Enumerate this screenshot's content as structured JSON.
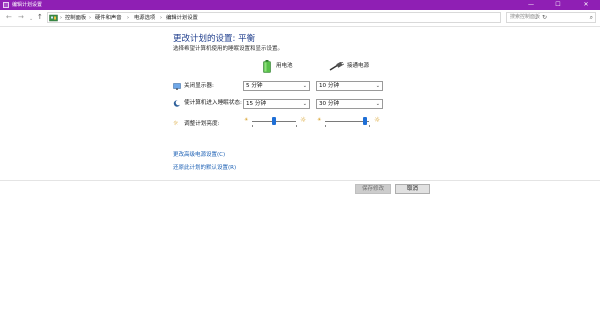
{
  "window": {
    "title": "编辑计划设置",
    "minimize": "—",
    "maximize": "☐",
    "close": "✕"
  },
  "nav": {
    "back": "←",
    "forward": "→",
    "recent": "⌄",
    "up": "↑"
  },
  "breadcrumbs": [
    "控制面板",
    "硬件和声音",
    "电源选项",
    "编辑计划设置"
  ],
  "breadcrumb_separator": "›",
  "search": {
    "placeholder": "搜索控制面板"
  },
  "heading": "更改计划的设置: 平衡",
  "subheading": "选择希望计算机使用的睡眠设置和显示设置。",
  "columns": {
    "battery": "用电池",
    "plugged": "接通电源"
  },
  "rows": [
    {
      "label": "关闭显示器:",
      "battery": "5 分钟",
      "plugged": "10 分钟"
    },
    {
      "label": "使计算机进入睡眠状态:",
      "battery": "15 分钟",
      "plugged": "30 分钟"
    }
  ],
  "brightness": {
    "label": "调整计划亮度:",
    "battery_level": 0.5,
    "plugged_level": 0.9
  },
  "links": {
    "advanced": "更改高级电源设置(C)",
    "restore": "还原此计划的默认设置(R)"
  },
  "buttons": {
    "save": "保存修改",
    "cancel": "取消"
  },
  "colors": {
    "titlebar": "#8f1fb4",
    "heading": "#1e3d8c",
    "link": "#1a5fb4",
    "slider": "#1f6fd6"
  }
}
